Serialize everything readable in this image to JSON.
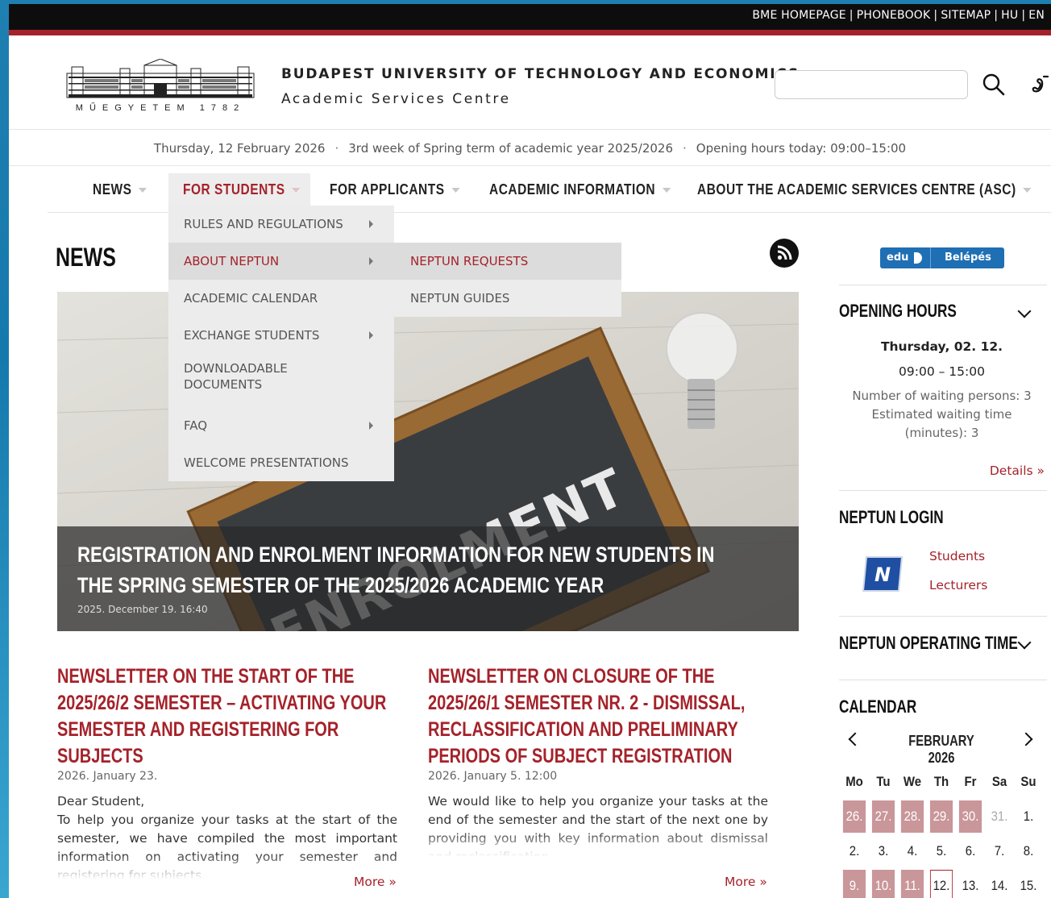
{
  "top_links": [
    "BME HOMEPAGE",
    "PHONEBOOK",
    "SITEMAP",
    "HU",
    "EN"
  ],
  "header": {
    "logo_text": "MŰEGYETEM 1782",
    "university": "BUDAPEST UNIVERSITY OF TECHNOLOGY AND ECONOMICS",
    "unit": "Academic Services Centre",
    "search_placeholder": ""
  },
  "info_line": {
    "date": "Thursday, 12 February 2026",
    "week": "3rd week of Spring term of academic year 2025/2026",
    "opening": "Opening hours today: 09:00–15:00"
  },
  "nav": {
    "items": [
      "NEWS",
      "FOR STUDENTS",
      "FOR APPLICANTS",
      "ACADEMIC INFORMATION",
      "ABOUT THE ACADEMIC SERVICES CENTRE (ASC)"
    ],
    "active": "FOR STUDENTS"
  },
  "dropdown": {
    "items": [
      "RULES AND REGULATIONS",
      "ABOUT NEPTUN",
      "ACADEMIC CALENDAR",
      "EXCHANGE STUDENTS",
      "DOWNLOADABLE DOCUMENTS",
      "FAQ",
      "WELCOME PRESENTATIONS"
    ],
    "highlighted": "ABOUT NEPTUN",
    "submenu": [
      "NEPTUN REQUESTS",
      "NEPTUN GUIDES"
    ]
  },
  "news": {
    "heading": "NEWS",
    "hero": {
      "image_text": "ENROLMENT",
      "title": "REGISTRATION AND ENROLMENT INFORMATION FOR NEW STUDENTS IN THE SPRING SEMESTER OF THE 2025/2026 ACADEMIC YEAR",
      "date": "2025. December 19. 16:40"
    },
    "articles": [
      {
        "title": "NEWSLETTER ON THE START OF THE 2025/26/2 SEMESTER – ACTIVATING YOUR SEMESTER AND REGISTERING FOR SUBJECTS",
        "date": "2026. January 23.",
        "salutation": "Dear Student,",
        "body": "To help you organize your tasks at the start of the semester, we have compiled the most important information on activating your semester and registering for subjects.",
        "more": "More »"
      },
      {
        "title": "NEWSLETTER ON CLOSURE OF THE 2025/26/1 SEMESTER NR. 2 - DISMISSAL, RECLASSIFICATION AND PRELIMINARY PERIODS OF SUBJECT REGISTRATION",
        "date": "2026. January 5. 12:00",
        "body": "We would like to help you organize your tasks at the end of the semester and the start of the next one by providing you with key information about dismissal and reclassification.",
        "more": "More »"
      }
    ]
  },
  "sidebar": {
    "eduid": {
      "left": "edu",
      "right": "Belépés"
    },
    "opening_hours": {
      "title": "OPENING HOURS",
      "day": "Thursday, 02. 12.",
      "hours": "09:00 – 15:00",
      "waiting": "Number of waiting persons: 3",
      "wait_time": "Estimated waiting time (minutes): 3",
      "details": "Details »"
    },
    "neptun_login": {
      "title": "NEPTUN LOGIN",
      "students": "Students",
      "lecturers": "Lecturers"
    },
    "neptun_operating": {
      "title": "NEPTUN OPERATING TIME"
    },
    "calendar": {
      "title": "CALENDAR",
      "month": "FEBRUARY 2026",
      "weekdays": [
        "Mo",
        "Tu",
        "We",
        "Th",
        "Fr",
        "Sa",
        "Su"
      ],
      "rows": [
        [
          {
            "d": "26.",
            "s": "hl"
          },
          {
            "d": "27.",
            "s": "hl"
          },
          {
            "d": "28.",
            "s": "hl"
          },
          {
            "d": "29.",
            "s": "hl"
          },
          {
            "d": "30.",
            "s": "hl"
          },
          {
            "d": "31.",
            "s": "muted"
          },
          {
            "d": "1.",
            "s": ""
          }
        ],
        [
          {
            "d": "2.",
            "s": ""
          },
          {
            "d": "3.",
            "s": ""
          },
          {
            "d": "4.",
            "s": ""
          },
          {
            "d": "5.",
            "s": ""
          },
          {
            "d": "6.",
            "s": ""
          },
          {
            "d": "7.",
            "s": ""
          },
          {
            "d": "8.",
            "s": ""
          }
        ],
        [
          {
            "d": "9.",
            "s": "hl"
          },
          {
            "d": "10.",
            "s": "hl"
          },
          {
            "d": "11.",
            "s": "hl"
          },
          {
            "d": "12.",
            "s": "today"
          },
          {
            "d": "13.",
            "s": ""
          },
          {
            "d": "14.",
            "s": ""
          },
          {
            "d": "15.",
            "s": ""
          }
        ]
      ]
    }
  },
  "colors": {
    "accent": "#a5222a",
    "calendar_highlight": "#c9969a",
    "topbar": "#0d0d0d"
  }
}
